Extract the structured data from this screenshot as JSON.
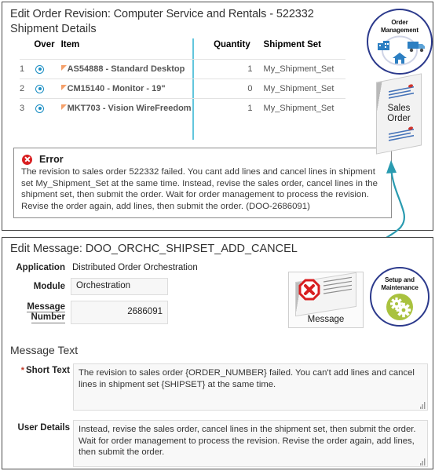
{
  "top_panel": {
    "page_title": "Edit Order Revision: Computer Service and Rentals - 522332",
    "page_subtitle": "Shipment Details",
    "table": {
      "headers": {
        "over": "Over",
        "item": "Item",
        "quantity": "Quantity",
        "shipment_set": "Shipment Set"
      },
      "rows": [
        {
          "index": "1",
          "over_icon": "radio-selected-icon",
          "flag_icon": "orange-corner-flag-icon",
          "item": "AS54888 - Standard Desktop",
          "quantity": "1",
          "shipment_set": "My_Shipment_Set"
        },
        {
          "index": "2",
          "over_icon": "radio-selected-icon",
          "flag_icon": "orange-corner-flag-icon",
          "item": "CM15140 - Monitor - 19\"",
          "quantity": "0",
          "shipment_set": "My_Shipment_Set"
        },
        {
          "index": "3",
          "over_icon": "radio-selected-icon",
          "flag_icon": "orange-corner-flag-icon",
          "item": "MKT703 - Vision WireFreedom",
          "quantity": "1",
          "shipment_set": "My_Shipment_Set"
        }
      ]
    },
    "error": {
      "icon": "error-circle-x-icon",
      "title": "Error",
      "text": "The revision to sales order 522332 failed. You cant add lines and cancel lines in shipment set My_Shipment_Set at the same time. Instead, revise the sales order, cancel lines in the shipment set, then submit the order. Wait for order management to process the revision. Revise the order again, add lines, then submit the order. (DOO-2686091)"
    },
    "badge_order_management": {
      "label_line1": "Order",
      "label_line2": "Management",
      "icons": [
        "factory-icon",
        "truck-icon",
        "house-icon"
      ]
    },
    "doc_sales_order": {
      "label_line1": "Sales",
      "label_line2": "Order",
      "icon": "document-page-icon"
    }
  },
  "bottom_panel": {
    "msg_title": "Edit Message: DOO_ORCHC_SHIPSET_ADD_CANCEL",
    "fields": {
      "application_label": "Application",
      "application_value": "Distributed Order Orchestration",
      "module_label": "Module",
      "module_value": "Orchestration",
      "message_number_label_line1": "Message",
      "message_number_label_line2": "Number",
      "message_number_value": "2686091"
    },
    "message_text_section": {
      "heading": "Message Text",
      "short_text_required_marker": "*",
      "short_text_label": "Short Text",
      "short_text_value": "The revision to sales order {ORDER_NUMBER} failed. You can't add lines and cancel lines in shipment set {SHIPSET} at the same time.",
      "user_details_label": "User Details",
      "user_details_value": "Instead, revise the sales order, cancel lines in the shipment set, then submit the order. Wait for order management to process the revision. Revise the order again, add lines, then submit the order."
    },
    "doc_message": {
      "label": "Message",
      "icon": "error-octagon-x-icon"
    },
    "badge_setup": {
      "label_line1": "Setup and",
      "label_line2": "Maintenance",
      "icon": "gears-icon"
    }
  },
  "colors": {
    "badge_border": "#2c3a8c",
    "error_red": "#d81e20",
    "accent_cyan": "#62c6dd",
    "flag_orange": "#f5a06a",
    "gear_green": "#a9c23f",
    "radio_blue": "#1c8fc4"
  }
}
